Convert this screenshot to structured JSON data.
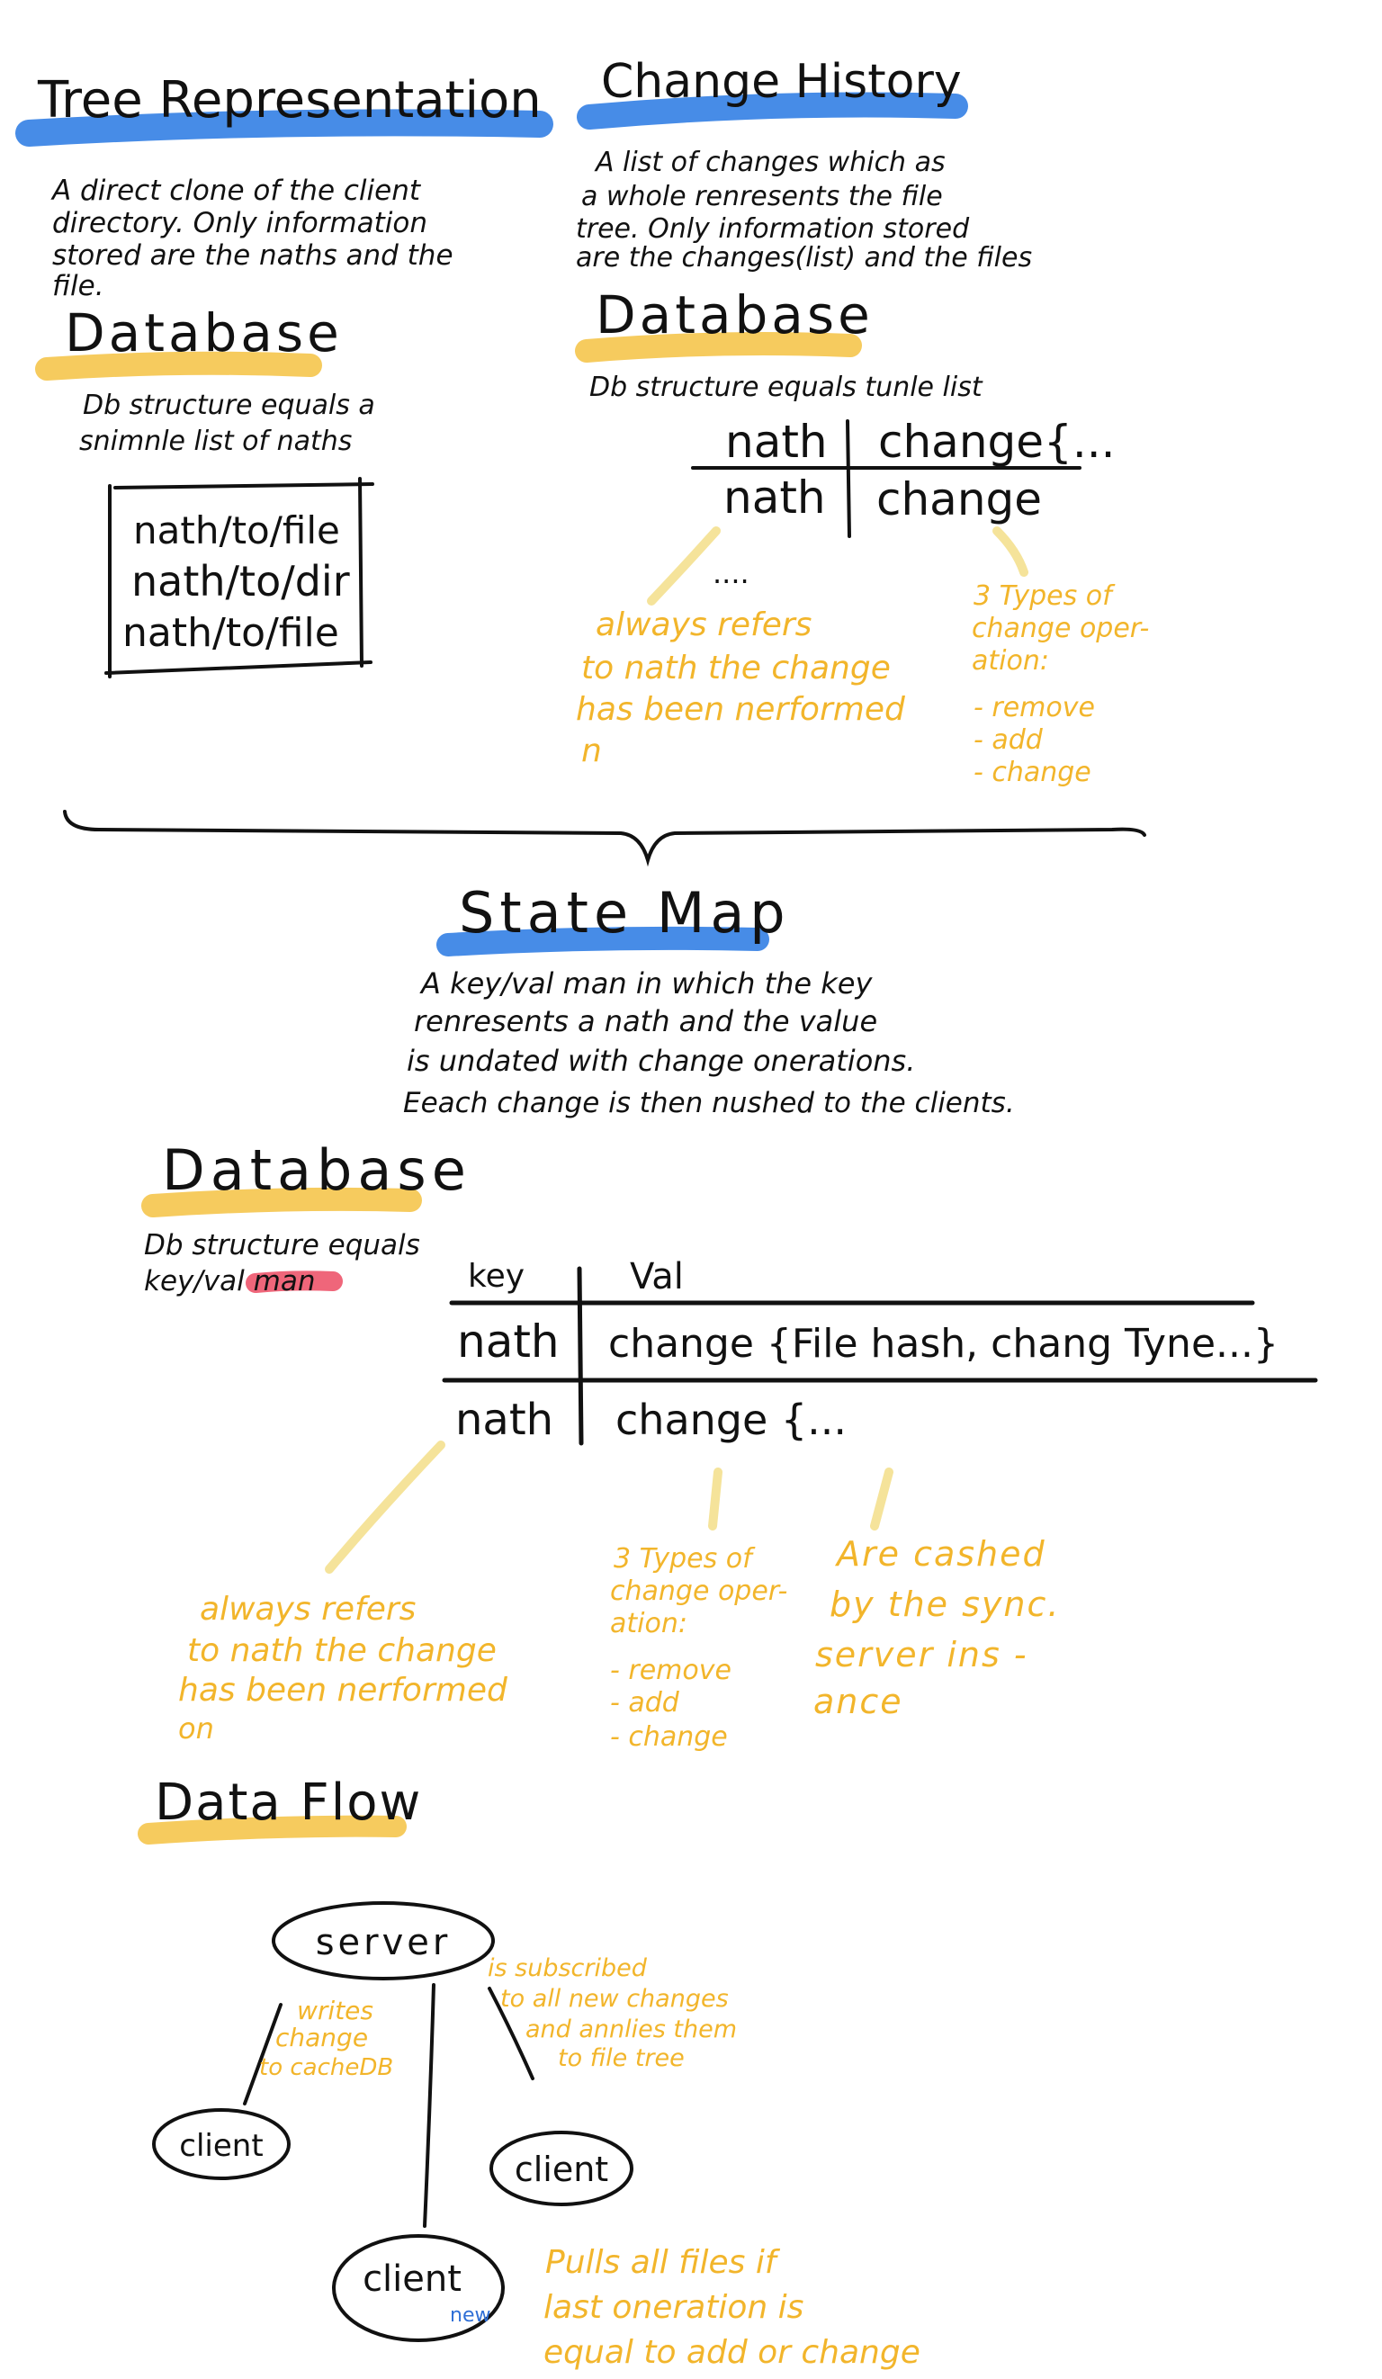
{
  "colors": {
    "ink": "#111111",
    "highlight_blue": "#3d86e6",
    "highlight_yellow": "#f5c242",
    "highlight_red": "#ec4b63",
    "note_yellow": "#f2b52b",
    "new_badge_blue": "#2f6fd6"
  },
  "tree_representation": {
    "title": "Tree Representation",
    "desc": [
      "A direct clone of the client",
      "directory. Only information",
      "stored are the naths and the",
      "file."
    ],
    "database": {
      "title": "Database",
      "desc": [
        "Db structure equals a",
        "snimnle list of naths"
      ],
      "paths": [
        "nath/to/file",
        "nath/to/dir",
        "nath/to/file"
      ]
    }
  },
  "change_history": {
    "title": "Change History",
    "desc": [
      "A list of changes which as",
      "a whole renresents the file",
      "tree. Only information stored",
      "are the changes(list) and the files"
    ],
    "database": {
      "title": "Database",
      "desc": "Db structure equals tunle list",
      "header": [
        "nath",
        "change{..."
      ],
      "row": [
        "nath",
        "change"
      ],
      "ellipsis": "....",
      "note_path": [
        "always refers",
        "to nath the change",
        "has been nerformed",
        "n"
      ],
      "note_types": [
        "3 Types of",
        "change oper-",
        "ation:",
        "- remove",
        "- add",
        "- change"
      ]
    }
  },
  "state_map": {
    "title": "State Map",
    "desc": [
      "A key/val man in which the key",
      "renresents a nath and the value",
      "is undated with  change onerations.",
      "Eeach change is then nushed to the clients."
    ],
    "database": {
      "title": "Database",
      "desc_line1": "Db structure equals",
      "desc_line2_prefix": "key/val ",
      "desc_line2_highlight": "man",
      "col_key": "key",
      "col_val": "Val",
      "row1": [
        "nath",
        "change {File hash, chang Tyne...}"
      ],
      "row2": [
        "nath",
        "change {..."
      ],
      "note_path": [
        "always refers",
        "to nath the change",
        "has been nerformed",
        "on"
      ],
      "note_types": [
        "3 Types of",
        "change oper-",
        "ation:",
        "- remove",
        "- add",
        "- change"
      ],
      "note_cache": [
        "Are cashed",
        "by the sync.",
        "server ins -",
        "ance"
      ]
    }
  },
  "data_flow": {
    "title": "Data Flow",
    "server": "server",
    "client_left": "client",
    "client_right": "client",
    "client_new": "client",
    "new_badge": "new",
    "note_writes": [
      "writes",
      "change",
      "to cacheDB"
    ],
    "note_subscribed": [
      "is subscribed",
      "to all new changes",
      "and annlies them",
      "to file tree"
    ],
    "note_pulls": [
      "Pulls all files if",
      "last oneration is",
      "equal to add or change"
    ]
  }
}
